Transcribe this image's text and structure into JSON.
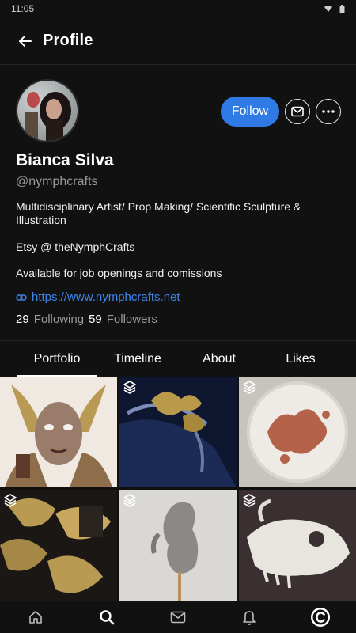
{
  "status_bar": {
    "time": "11:05"
  },
  "header": {
    "title": "Profile"
  },
  "profile": {
    "name": "Bianca Silva",
    "handle": "@nymphcrafts",
    "bio_line_1": "Multidisciplinary Artist/ Prop Making/ Scientific Sculpture & Illustration",
    "bio_line_2": "Etsy @ theNymphCrafts",
    "bio_line_3": "Available for job openings and comissions",
    "link": "https://www.nymphcrafts.net",
    "following_count": "29",
    "following_label": "Following",
    "followers_count": "59",
    "followers_label": "Followers"
  },
  "actions": {
    "follow_label": "Follow"
  },
  "tabs": [
    {
      "label": "Portfolio",
      "active": true
    },
    {
      "label": "Timeline",
      "active": false
    },
    {
      "label": "About",
      "active": false
    },
    {
      "label": "Likes",
      "active": false
    }
  ],
  "grid": {
    "tiles": [
      {
        "subject": "illustration of woman with gold leaf headdress",
        "multi": false
      },
      {
        "subject": "gold oak leaf beaded headband",
        "multi": true
      },
      {
        "subject": "petri dish with red sculpted leaves",
        "multi": true
      },
      {
        "subject": "gold leaf sculptures in box",
        "multi": true
      },
      {
        "subject": "grey frog creature sculpture",
        "multi": true
      },
      {
        "subject": "white skull sculpture",
        "multi": true
      }
    ]
  },
  "bottom_nav": {
    "items": [
      "home-icon",
      "search-icon",
      "mail-icon",
      "bell-icon",
      "profile-logo-icon"
    ]
  },
  "colors": {
    "accent": "#2f7ae5",
    "link": "#3d86e8",
    "background": "#111111"
  }
}
